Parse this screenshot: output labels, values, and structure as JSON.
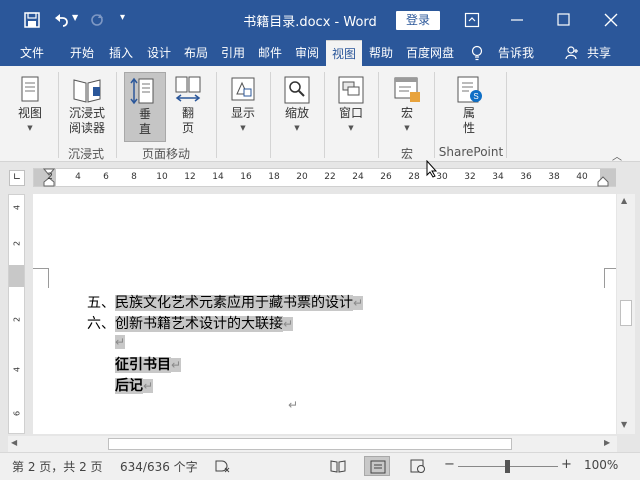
{
  "title_bar": {
    "title": "书籍目录.docx  -  Word",
    "login_label": "登录",
    "undo_icon": "undo-icon",
    "redo_icon": "redo-icon",
    "save_icon": "save-icon"
  },
  "menu": {
    "tabs": [
      "文件",
      "开始",
      "插入",
      "设计",
      "布局",
      "引用",
      "邮件",
      "审阅",
      "视图",
      "帮助",
      "百度网盘"
    ],
    "active": "视图",
    "tell_me": "告诉我",
    "share": "共享"
  },
  "ribbon": {
    "buttons": {
      "view": "视图",
      "immersive_reader_1": "沉浸式",
      "immersive_reader_2": "阅读器",
      "vertical_1": "垂",
      "vertical_2": "直",
      "page_flip_1": "翻",
      "page_flip_2": "页",
      "show": "显示",
      "zoom": "缩放",
      "window": "窗口",
      "macro": "宏",
      "properties_1": "属",
      "properties_2": "性"
    },
    "groups": {
      "immersive": "沉浸式",
      "page_movement": "页面移动",
      "macro": "宏",
      "sharepoint": "SharePoint"
    }
  },
  "ruler": {
    "marks": [
      "2",
      "4",
      "6",
      "8",
      "10",
      "12",
      "14",
      "16",
      "18",
      "20",
      "22",
      "24",
      "26",
      "28",
      "30",
      "32",
      "34",
      "36",
      "38",
      "40"
    ],
    "vmarks": [
      "4",
      "2",
      "2",
      "4",
      "6"
    ]
  },
  "document": {
    "lines": [
      {
        "prefix": "五、",
        "text": "民族文化艺术元素应用于藏书票的设计"
      },
      {
        "prefix": "六、",
        "text": "创新书籍艺术设计的大联接"
      }
    ],
    "heading1": "征引书目",
    "heading2": "后记",
    "para_mark": "↵"
  },
  "status": {
    "page": "第 2 页，共 2 页",
    "words": "634/636 个字",
    "zoom": "100%",
    "zoom_minus": "−",
    "zoom_plus": "+"
  }
}
